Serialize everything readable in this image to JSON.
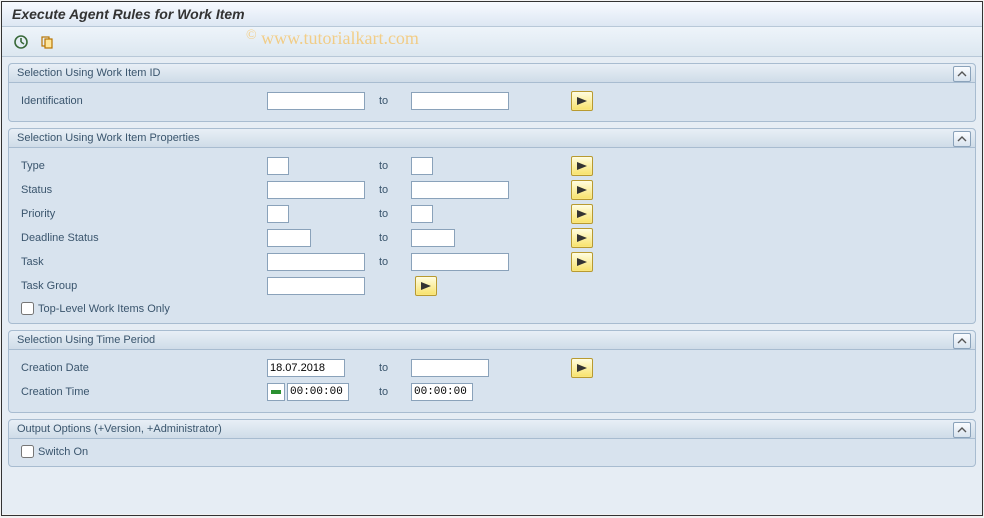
{
  "window": {
    "title": "Execute Agent Rules for Work Item"
  },
  "watermark": "© www.tutorialkart.com",
  "groups": {
    "id": {
      "title": "Selection Using Work Item ID",
      "identification_label": "Identification",
      "identification_from": "",
      "to_label": "to",
      "identification_to": ""
    },
    "props": {
      "title": "Selection Using Work Item Properties",
      "to_label": "to",
      "type_label": "Type",
      "type_from": "",
      "type_to": "",
      "status_label": "Status",
      "status_from": "",
      "status_to": "",
      "priority_label": "Priority",
      "priority_from": "",
      "priority_to": "",
      "deadline_label": "Deadline Status",
      "deadline_from": "",
      "deadline_to": "",
      "task_label": "Task",
      "task_from": "",
      "task_to": "",
      "taskgroup_label": "Task Group",
      "taskgroup_from": "",
      "toplevel_label": "Top-Level Work Items Only",
      "toplevel_checked": false
    },
    "time": {
      "title": "Selection Using Time Period",
      "to_label": "to",
      "cdate_label": "Creation Date",
      "cdate_from": "18.07.2018",
      "cdate_to": "",
      "ctime_label": "Creation Time",
      "ctime_from": "00:00:00",
      "ctime_to": "00:00:00"
    },
    "output": {
      "title": "Output Options (+Version, +Administrator)",
      "switch_label": "Switch On",
      "switch_checked": false
    }
  }
}
